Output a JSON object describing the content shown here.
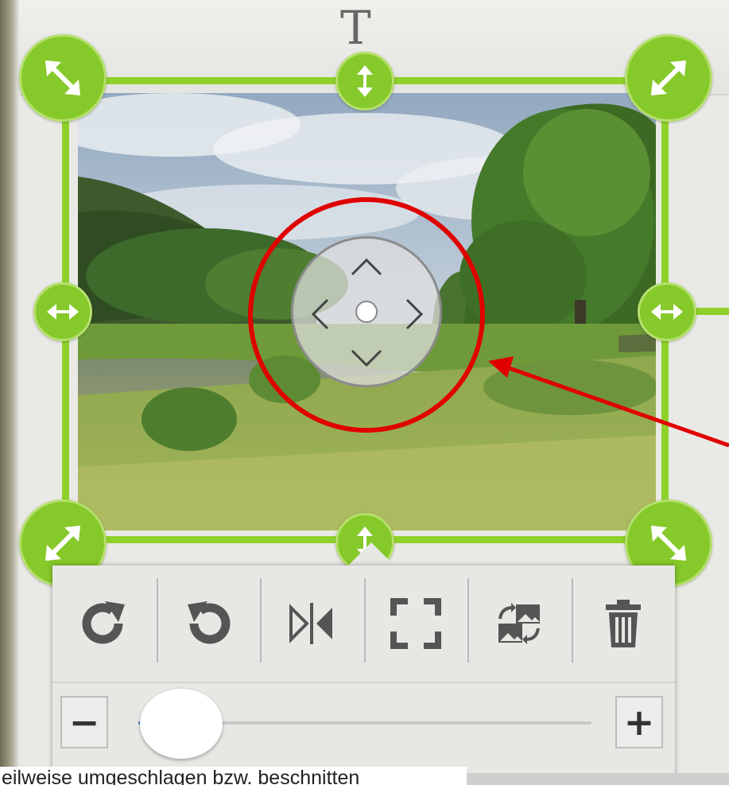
{
  "editor": {
    "text_tool_label": "T",
    "accent_color": "#8fd12b",
    "annotation_color": "#e00000"
  },
  "handles": {
    "corner_icons": [
      "resize-nwse-icon",
      "resize-nesw-icon",
      "resize-nesw-icon",
      "resize-nwse-icon"
    ],
    "side_icons": [
      "resize-vertical-icon",
      "resize-horizontal-icon",
      "resize-horizontal-icon",
      "resize-vertical-icon"
    ]
  },
  "move_control": {
    "icons": [
      "chevron-up-icon",
      "chevron-left-icon",
      "chevron-right-icon",
      "chevron-down-icon",
      "center-dot-icon"
    ]
  },
  "toolbar": {
    "tools": [
      {
        "name": "rotate-clockwise",
        "icon": "rotate-cw-icon"
      },
      {
        "name": "rotate-counterclockwise",
        "icon": "rotate-ccw-icon"
      },
      {
        "name": "flip-horizontal",
        "icon": "flip-icon"
      },
      {
        "name": "fit-frame",
        "icon": "fullscreen-icon"
      },
      {
        "name": "replace-image",
        "icon": "swap-image-icon"
      },
      {
        "name": "delete",
        "icon": "trash-icon"
      }
    ],
    "zoom": {
      "minus_label": "−",
      "plus_label": "+",
      "level": 0.02
    }
  },
  "caption": {
    "text": "eilweise umgeschlagen bzw. beschnitten"
  }
}
